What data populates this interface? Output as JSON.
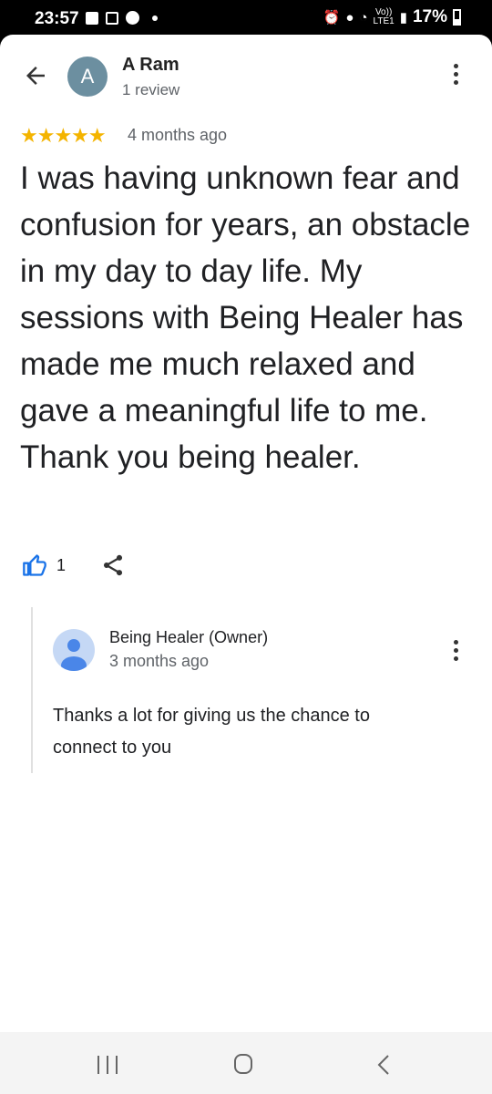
{
  "status_bar": {
    "time": "23:57",
    "network_line1": "Vo))",
    "network_line2": "LTE1",
    "battery": "17%"
  },
  "header": {
    "avatar_letter": "A",
    "name": "A Ram",
    "review_count": "1 review"
  },
  "review": {
    "stars": "★★★★★",
    "rating": 5,
    "time": "4 months ago",
    "text": "I was having unknown fear and confusion for years, an obstacle in my day to day life. My sessions with Being Healer has made me much relaxed and gave a meaningful life to me.  Thank you being healer.",
    "like_count": "1"
  },
  "reply": {
    "owner_name": "Being Healer (Owner)",
    "time": "3 months ago",
    "text": "Thanks a lot for giving us the chance to connect to you"
  },
  "icons": {
    "back": "arrow-back-icon",
    "menu": "more-vert-icon",
    "like": "thumbs-up-icon",
    "share": "share-icon"
  },
  "colors": {
    "star": "#f4b400",
    "like": "#1a73e8",
    "avatar": "#6c8fa0"
  }
}
